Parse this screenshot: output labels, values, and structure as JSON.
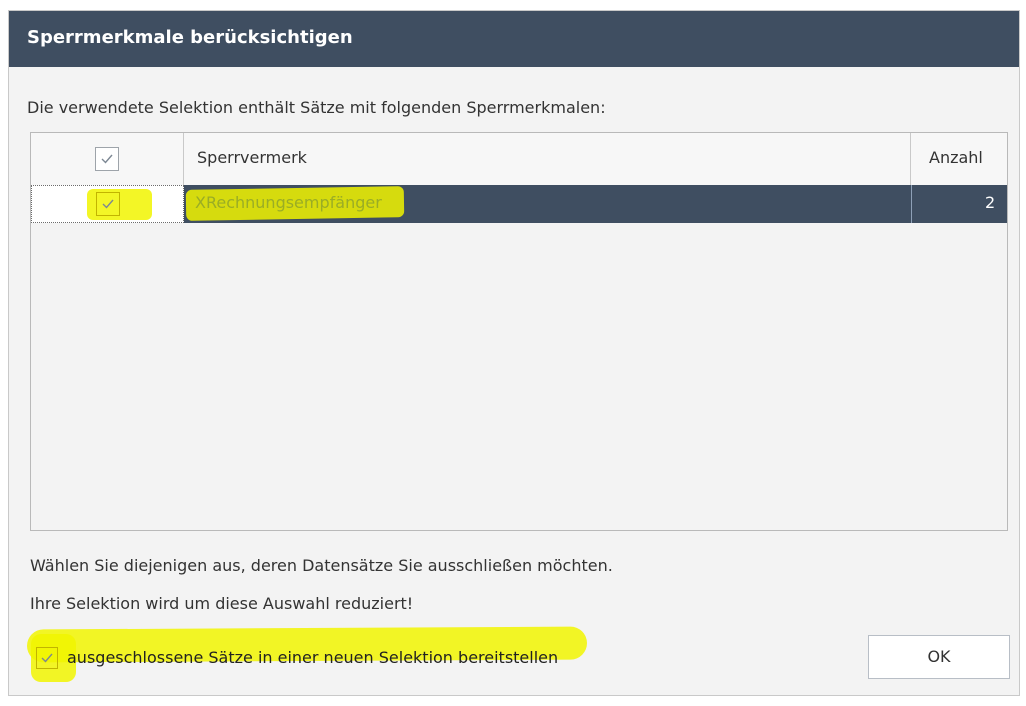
{
  "dialog": {
    "title": "Sperrmerkmale berücksichtigen",
    "intro": "Die verwendete Selektion enthält Sätze mit folgenden Sperrmerkmalen:",
    "grid": {
      "headers": {
        "label": "Sperrvermerk",
        "count": "Anzahl"
      },
      "rows": [
        {
          "label": "XRechnungsempfänger",
          "count": "2"
        }
      ]
    },
    "info_line_1": "Wählen Sie diejenigen aus, deren Datensätze Sie ausschließen möchten.",
    "info_line_2": "Ihre Selektion wird um diese Auswahl reduziert!",
    "bottom_checkbox_label": "ausgeschlossene Sätze in einer neuen Selektion bereitstellen",
    "ok_label": "OK"
  },
  "colors": {
    "title_bar": "#3f4e61",
    "selected_row": "#3f4e61",
    "highlight": "#f1f500"
  }
}
